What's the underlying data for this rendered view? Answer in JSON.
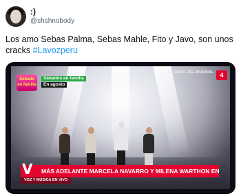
{
  "author": {
    "display_name": ":)",
    "handle": "@shshnobody"
  },
  "tweet": {
    "text": "Los amo Sebas Palma, Sebas Mahle, Fito y Javo,  son unos cracks ",
    "hashtag": "#Lavozperu"
  },
  "media": {
    "badge": "Sábado en familia",
    "promo_line1": "Sábados en familia",
    "promo_line2": "En agosto",
    "channel_text": "EL CANAL DEL MUNDIAL",
    "channel_logo": "4",
    "ticker_text": "MÁS ADELANTE MARCELA NAVARRO Y MILENA WARTHON EN VIVO",
    "sub_ticker_text": "VOZ Y MÚSICA EN VIVO",
    "brand_color": "#e3052f"
  }
}
